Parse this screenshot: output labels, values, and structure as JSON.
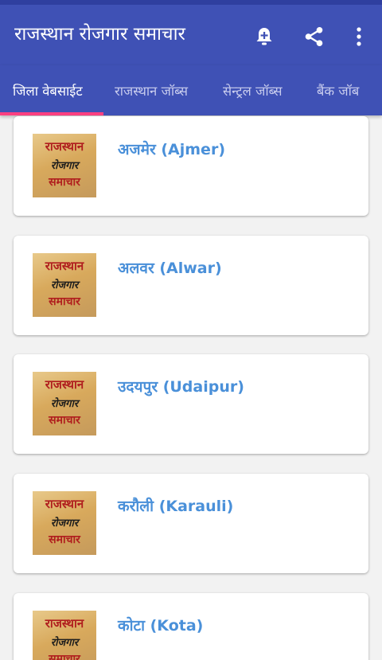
{
  "app_bar": {
    "title": "राजस्थान रोजगार समाचार",
    "actions": [
      "add-alert-icon",
      "share-icon",
      "more-vert-icon"
    ]
  },
  "tabs": [
    {
      "label": "जिला वेबसाईट",
      "active": true
    },
    {
      "label": "राजस्थान जॉब्स",
      "active": false
    },
    {
      "label": "सेन्ट्रल जॉब्स",
      "active": false
    },
    {
      "label": "बैंक जॉब",
      "active": false
    }
  ],
  "thumbnail": {
    "line1": "राजस्थान",
    "line2": "रोजगार",
    "line3": "समाचार"
  },
  "items": [
    {
      "title": "अजमेर (Ajmer)"
    },
    {
      "title": "अलवर (Alwar)"
    },
    {
      "title": "उदयपुर (Udaipur)"
    },
    {
      "title": "करौली (Karauli)"
    },
    {
      "title": "कोटा (Kota)"
    }
  ],
  "colors": {
    "primary": "#3f51b5",
    "accent": "#ff4081",
    "item_title": "#4a90d9"
  }
}
